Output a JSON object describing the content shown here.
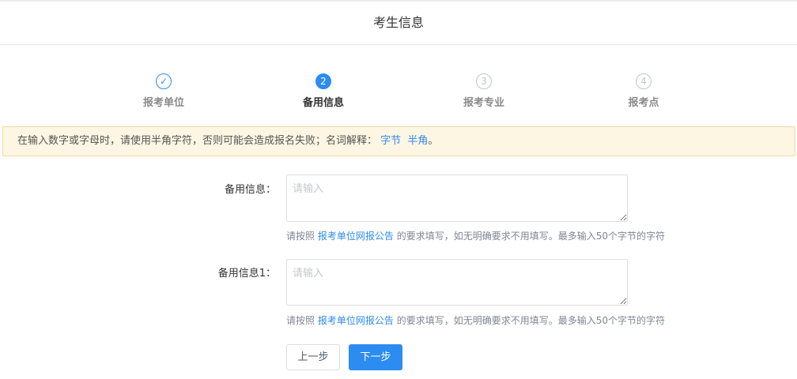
{
  "header": {
    "title": "考生信息"
  },
  "steps": [
    {
      "label": "报考单位",
      "marker": "✓",
      "state": "done"
    },
    {
      "label": "备用信息",
      "marker": "2",
      "state": "active"
    },
    {
      "label": "报考专业",
      "marker": "3",
      "state": "pending"
    },
    {
      "label": "报考点",
      "marker": "4",
      "state": "pending"
    }
  ],
  "notice": {
    "text": "在输入数字或字母时，请使用半角字符，否则可能会造成报名失败；名词解释：",
    "link1": "字节",
    "link2": "半角",
    "end": "。"
  },
  "form": {
    "fields": [
      {
        "label": "备用信息：",
        "placeholder": "请输入",
        "value": "",
        "hint_prefix": "请按照",
        "hint_link": "报考单位网报公告",
        "hint_suffix": "的要求填写，如无明确要求不用填写。最多输入50个字节的字符"
      },
      {
        "label": "备用信息1：",
        "placeholder": "请输入",
        "value": "",
        "hint_prefix": "请按照",
        "hint_link": "报考单位网报公告",
        "hint_suffix": "的要求填写，如无明确要求不用填写。最多输入50个字节的字符"
      }
    ]
  },
  "buttons": {
    "prev": "上一步",
    "next": "下一步"
  },
  "colors": {
    "accent": "#2d8cf0",
    "notice_bg": "#fdf6e3",
    "notice_border": "#f5d9a0",
    "inactive": "#c0c4cc"
  }
}
